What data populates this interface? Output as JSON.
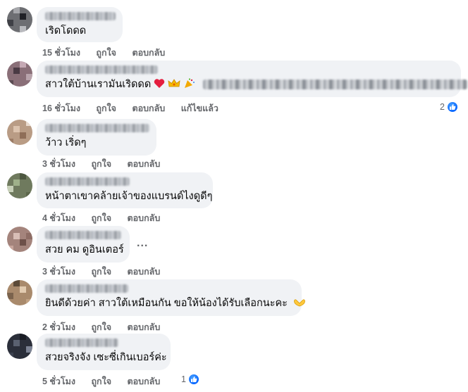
{
  "actions": {
    "like": "ถูกใจ",
    "reply": "ตอบกลับ",
    "edit": "แก้ไขแล้ว"
  },
  "comments": [
    {
      "text": "เริดโดดด",
      "time": "15 ชั่วโมง"
    },
    {
      "name": "Prachu Dave Chotechuang",
      "text": "สาวใต้บ้านเรามันเริดดด",
      "emoji": "heart, crown, party",
      "time": "16 ชั่วโมง",
      "reactions": "2"
    },
    {
      "text": "ว้าว เริ่ดๆ",
      "time": "3 ชั่วโมง"
    },
    {
      "text": "หน้าตาเขาคล้ายเจ้าของแบรนด์ไงดูดีๆ",
      "time": "4 ชั่วโมง"
    },
    {
      "text": "สวย คม ดูอินเตอร์",
      "time": "3 ชั่วโมง",
      "more": "..."
    },
    {
      "text": "ยินดีด้วยค่า สาวใต้เหมือนกัน ขอให้น้องได้รับเลือกนะคะ",
      "emoji": "heart-hands",
      "time": "2 ชั่วโมง"
    },
    {
      "name": "Tompesta Sanary",
      "text": "สวยจริงจัง เซะซี่เกินเบอร์ค่ะ",
      "time": "5 ชั่วโมง",
      "reactions": "1"
    }
  ],
  "colors": {
    "bubble": "#f0f2f5",
    "meta": "#65676b",
    "like": "#0866ff",
    "heart": "#e41e3f"
  },
  "icons": [
    "like-icon",
    "heart-emoji",
    "crown-emoji",
    "party-emoji",
    "heart-hands-emoji",
    "more-icon"
  ]
}
